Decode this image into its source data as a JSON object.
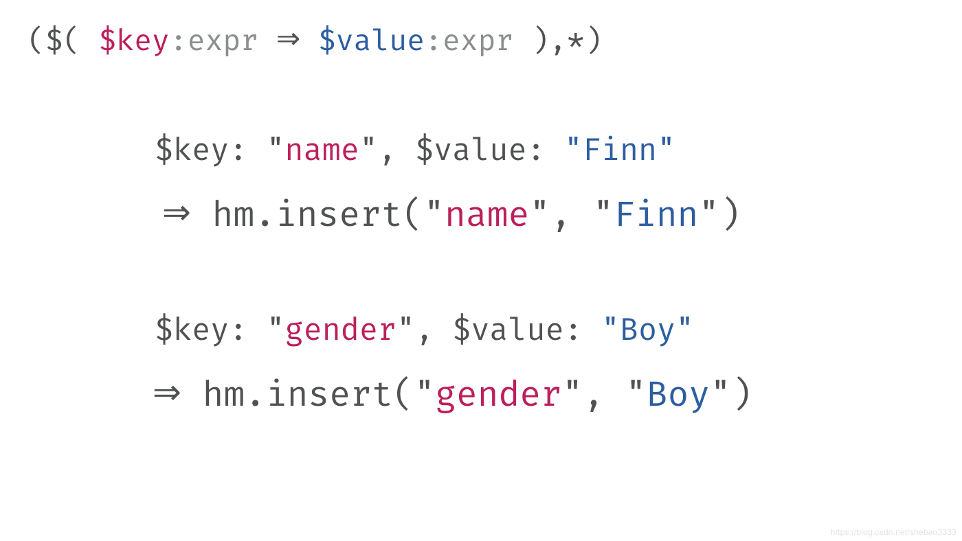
{
  "colors": {
    "gray": "#4f5250",
    "muted": "#8b8f8c",
    "pink": "#bc1f5b",
    "blue": "#2c5ea0"
  },
  "glyphs": {
    "double_arrow": "⇒"
  },
  "pattern": {
    "open": "($( ",
    "key_var": "$key",
    "colon": ":",
    "expr": "expr",
    "mid": " ",
    "value_var": "$value",
    "close": " ),*)"
  },
  "ex1": {
    "bind_prefix": "$key: ",
    "key_q": "\"",
    "key_inner": "name",
    "bind_mid": ", $value: ",
    "val": "\"Finn\"",
    "call_pre": " hm.insert(",
    "call_q": "\"",
    "call_key_inner": "name",
    "call_comma": ", ",
    "call_val_q": "\"",
    "call_val_inner": "Finn",
    "call_close": ")",
    "indent": " "
  },
  "ex2": {
    "bind_prefix": "$key: ",
    "key_q": "\"",
    "key_inner": "gender",
    "bind_mid": ", $value: ",
    "val": "\"Boy\"",
    "call_pre": " hm.insert(",
    "call_q": "\"",
    "call_key_inner": "gender",
    "call_comma": ", ",
    "call_val_q": "\"",
    "call_val_inner": "Boy",
    "call_close": ")"
  },
  "watermark": "https://blog.csdn.net/shebao3333"
}
